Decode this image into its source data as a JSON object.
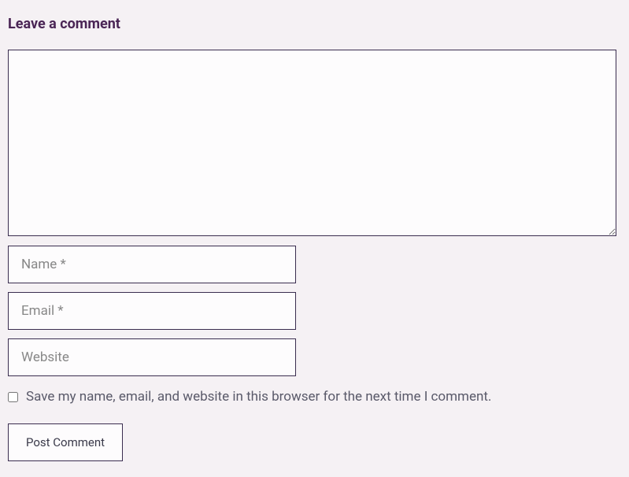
{
  "form": {
    "title": "Leave a comment",
    "comment_placeholder": "",
    "name_placeholder": "Name *",
    "email_placeholder": "Email *",
    "website_placeholder": "Website",
    "save_info_label": "Save my name, email, and website in this browser for the next time I comment.",
    "submit_label": "Post Comment"
  }
}
